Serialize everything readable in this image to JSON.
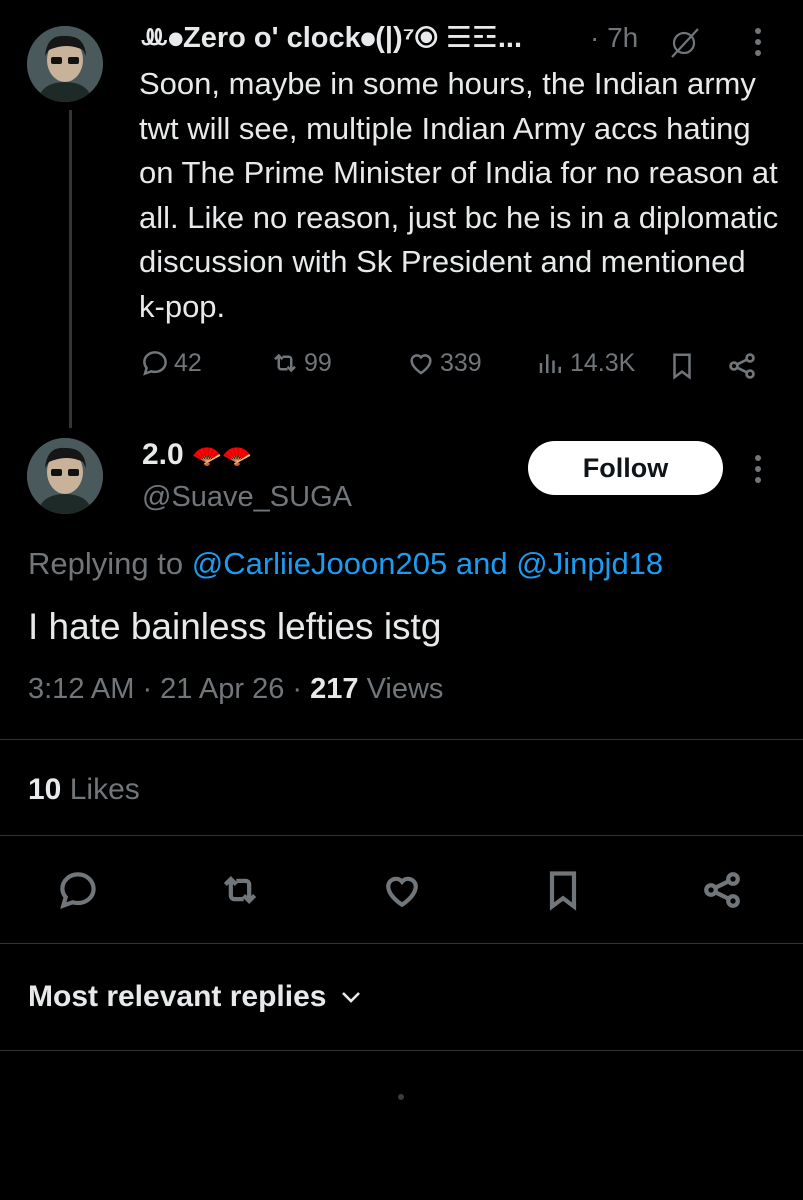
{
  "tweet1": {
    "display_name": "ꔛ⦁Zero o' clock⦁(|)⁷⦿ ☰☲...",
    "time": "· 7h",
    "body": "Soon, maybe in some hours, the Indian army twt will see, multiple Indian Army accs hating on The Prime Minister of India for no reason at all. Like no reason, just bc he is in a diplomatic discussion with Sk President and mentioned k-pop.",
    "stats": {
      "replies": "42",
      "retweets": "99",
      "likes": "339",
      "views": "14.3K"
    }
  },
  "tweet2": {
    "display_name": "2.0",
    "name_emoji": "🪭🪭",
    "handle": "@Suave_SUGA",
    "follow_label": "Follow",
    "replying_prefix": "Replying to",
    "reply_user1": "@CarliieJooon205",
    "reply_and": "and",
    "reply_user2": "@Jinpjd18",
    "text": "I hate bainless lefties istg",
    "timestamp": "3:12 AM · 21 Apr 26 ·",
    "views_count": "217",
    "views_label": "Views",
    "likes_count": "10",
    "likes_label": "Likes"
  },
  "replies_header": "Most relevant replies",
  "icons": [
    "reply-icon",
    "retweet-icon",
    "like-icon",
    "views-icon",
    "bookmark-icon",
    "share-icon",
    "more-icon",
    "chevron-down-icon",
    "verified-off-icon"
  ],
  "colors": {
    "background": "#000000",
    "text": "#e7e9ea",
    "muted": "#71767b",
    "link": "#1d9bf0",
    "follow_bg": "#ffffff"
  }
}
